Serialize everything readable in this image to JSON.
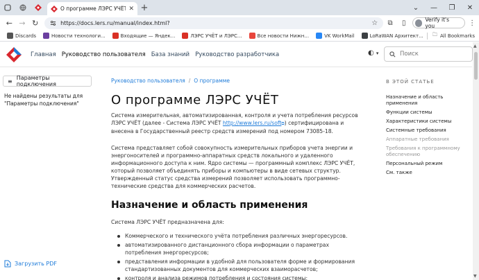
{
  "browser": {
    "active_tab_title": "О программе ЛЭРС УЧЁТ | Док",
    "url": "https://docs.lers.ru/manual/index.html?",
    "profile_label": "Verify it's you",
    "bookmarks": [
      {
        "label": "Discards",
        "color": "#555"
      },
      {
        "label": "Новости технологи...",
        "color": "#6b3fa0"
      },
      {
        "label": "Входящие — Яндек...",
        "color": "#d93025"
      },
      {
        "label": "ЛЭРС УЧЁТ и ЛЭРС...",
        "color": "#d93025"
      },
      {
        "label": "Все новости Нижн...",
        "color": "#e8453c"
      },
      {
        "label": "VK WorkMail",
        "color": "#2787f5"
      },
      {
        "label": "LoRaWAN Архитект...",
        "color": "#3c4043"
      }
    ],
    "all_bookmarks_label": "All Bookmarks"
  },
  "site": {
    "nav": [
      {
        "label": "Главная",
        "active": false
      },
      {
        "label": "Руководство пользователя",
        "active": true
      },
      {
        "label": "База знаний",
        "active": false
      },
      {
        "label": "Руководство разработчика",
        "active": false
      }
    ],
    "search_placeholder": "Поиск"
  },
  "sidebar": {
    "params_label": "Параметры подключения",
    "no_results": "Не найдены результаты для \"Параметры подключения\"",
    "download_pdf": "Загрузить PDF"
  },
  "main": {
    "breadcrumb": [
      "Руководство пользователя",
      "О программе"
    ],
    "title": "О программе ЛЭРС УЧЁТ",
    "para1_before": "Система измерительная, автоматизированная, контроля и учета потребления ресурсов ЛЭРС УЧЁТ (далее - Система ЛЭРС УЧЁТ ",
    "para1_link": "http://www.lers.ru/soft",
    "para1_after": ") сертифицирована и внесена в Государственный реестр средств измерений под номером 73085-18.",
    "para2": "Система представляет собой совокупность измерительных приборов учета энергии и энергоносителей и программно-аппаратных средств локального и удаленного информационного доступа к ним. Ядро системы — программный комплекс ЛЭРС УЧЁТ, который позволяет объединять приборы и компьютеры в виде сетевых структур. Утвержденный статус средства измерений позволяет использовать программно-технические средства для коммерческих расчетов.",
    "h2": "Назначение и область применения",
    "para3": "Система ЛЭРС УЧЁТ предназначена для:",
    "bullets": [
      "Коммерческого и технического учёта потребления различных энергоресурсов.",
      "автоматизированного дистанционного сбора информации о параметрах потребления энергоресурсов;",
      "представления информации в удобной для пользователя форме и формирования стандартизованных документов для коммерческих взаиморасчетов;",
      "контроля и анализа режимов потребления и состояния системы;"
    ]
  },
  "toc": {
    "title": "В ЭТОЙ СТАТЬЕ",
    "items": [
      {
        "label": "Назначение и область применения",
        "muted": false
      },
      {
        "label": "Функции системы",
        "muted": false
      },
      {
        "label": "Характеристики системы",
        "muted": false
      },
      {
        "label": "Системные требования",
        "muted": false
      },
      {
        "label": "Аппаратные требования",
        "muted": true
      },
      {
        "label": "Требования к программному обеспечению",
        "muted": true
      },
      {
        "label": "Персональный режим",
        "muted": false
      },
      {
        "label": "См. также",
        "muted": false
      }
    ]
  }
}
